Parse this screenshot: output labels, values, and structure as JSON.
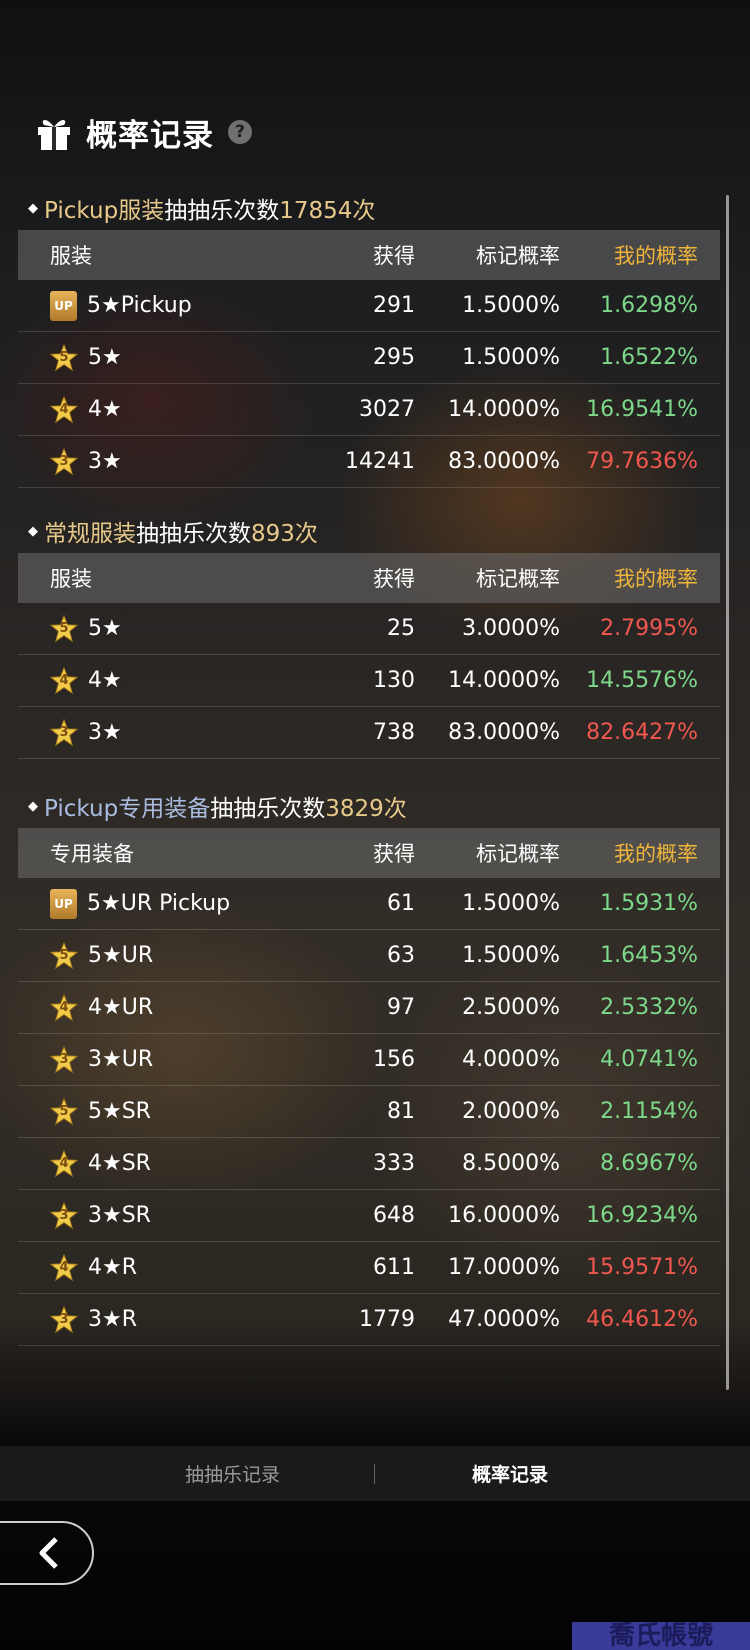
{
  "header": {
    "title": "概率记录",
    "help_icon": "?"
  },
  "sections": [
    {
      "title_pre": "Pickup服装",
      "title_mid": "抽抽乐次数",
      "title_num": "17854次",
      "pre_color": "gold",
      "columns": {
        "name": "服装",
        "got": "获得",
        "rate": "标记概率",
        "mine": "我的概率"
      },
      "rows": [
        {
          "badge": "UP",
          "name": "5★Pickup",
          "got": "291",
          "rate": "1.5000%",
          "mine": "1.6298%",
          "status": "green"
        },
        {
          "badge": "5",
          "name": "5★",
          "got": "295",
          "rate": "1.5000%",
          "mine": "1.6522%",
          "status": "green"
        },
        {
          "badge": "4",
          "name": "4★",
          "got": "3027",
          "rate": "14.0000%",
          "mine": "16.9541%",
          "status": "green"
        },
        {
          "badge": "3",
          "name": "3★",
          "got": "14241",
          "rate": "83.0000%",
          "mine": "79.7636%",
          "status": "red"
        }
      ]
    },
    {
      "title_pre": "常规服装",
      "title_mid": "抽抽乐次数",
      "title_num": "893次",
      "pre_color": "gold",
      "columns": {
        "name": "服装",
        "got": "获得",
        "rate": "标记概率",
        "mine": "我的概率"
      },
      "rows": [
        {
          "badge": "5",
          "name": "5★",
          "got": "25",
          "rate": "3.0000%",
          "mine": "2.7995%",
          "status": "red"
        },
        {
          "badge": "4",
          "name": "4★",
          "got": "130",
          "rate": "14.0000%",
          "mine": "14.5576%",
          "status": "green"
        },
        {
          "badge": "3",
          "name": "3★",
          "got": "738",
          "rate": "83.0000%",
          "mine": "82.6427%",
          "status": "red"
        }
      ]
    },
    {
      "title_pre": "Pickup专用装备",
      "title_mid": "抽抽乐次数",
      "title_num": "3829次",
      "pre_color": "blue",
      "columns": {
        "name": "专用装备",
        "got": "获得",
        "rate": "标记概率",
        "mine": "我的概率"
      },
      "rows": [
        {
          "badge": "UP",
          "name": "5★UR Pickup",
          "got": "61",
          "rate": "1.5000%",
          "mine": "1.5931%",
          "status": "green"
        },
        {
          "badge": "5",
          "name": "5★UR",
          "got": "63",
          "rate": "1.5000%",
          "mine": "1.6453%",
          "status": "green"
        },
        {
          "badge": "4",
          "name": "4★UR",
          "got": "97",
          "rate": "2.5000%",
          "mine": "2.5332%",
          "status": "green"
        },
        {
          "badge": "3",
          "name": "3★UR",
          "got": "156",
          "rate": "4.0000%",
          "mine": "4.0741%",
          "status": "green"
        },
        {
          "badge": "5",
          "name": "5★SR",
          "got": "81",
          "rate": "2.0000%",
          "mine": "2.1154%",
          "status": "green"
        },
        {
          "badge": "4",
          "name": "4★SR",
          "got": "333",
          "rate": "8.5000%",
          "mine": "8.6967%",
          "status": "green"
        },
        {
          "badge": "3",
          "name": "3★SR",
          "got": "648",
          "rate": "16.0000%",
          "mine": "16.9234%",
          "status": "green"
        },
        {
          "badge": "4",
          "name": "4★R",
          "got": "611",
          "rate": "17.0000%",
          "mine": "15.9571%",
          "status": "red"
        },
        {
          "badge": "3",
          "name": "3★R",
          "got": "1779",
          "rate": "47.0000%",
          "mine": "46.4612%",
          "status": "red"
        }
      ]
    }
  ],
  "tabs": {
    "draw_record": "抽抽乐记录",
    "rate_record": "概率记录"
  },
  "watermark": "喬氏帳號",
  "colors": {
    "gold": "#e7c98a",
    "blue": "#a9bce0",
    "green": "#7ed88a",
    "red": "#f0584f",
    "header_accent": "#f0b43a"
  }
}
